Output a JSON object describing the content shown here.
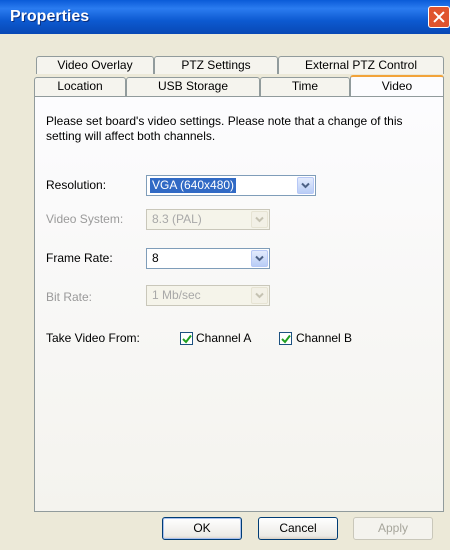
{
  "window": {
    "title": "Properties"
  },
  "tabs": {
    "row_back": [
      {
        "label": "Video Overlay"
      },
      {
        "label": "PTZ Settings"
      },
      {
        "label": "External PTZ Control"
      }
    ],
    "row_front": [
      {
        "label": "Location"
      },
      {
        "label": "USB Storage"
      },
      {
        "label": "Time"
      },
      {
        "label": "Video",
        "active": true
      }
    ]
  },
  "panel": {
    "description": "Please set board's video settings. Please note that a change of this setting will affect both channels.",
    "resolution": {
      "label": "Resolution:",
      "value": "VGA (640x480)",
      "enabled": true
    },
    "video_system": {
      "label": "Video System:",
      "value": "8.3 (PAL)",
      "enabled": false
    },
    "frame_rate": {
      "label": "Frame Rate:",
      "value": "8",
      "enabled": true
    },
    "bit_rate": {
      "label": "Bit Rate:",
      "value": "1 Mb/sec",
      "enabled": false
    },
    "take_video_from": {
      "label": "Take Video From:",
      "channel_a": {
        "label": "Channel A",
        "checked": true
      },
      "channel_b": {
        "label": "Channel B",
        "checked": true
      }
    }
  },
  "buttons": {
    "ok": "OK",
    "cancel": "Cancel",
    "apply": "Apply"
  },
  "colors": {
    "titlebar": "#0a5bd8",
    "active_tab_accent": "#f2a33a",
    "selection": "#316ac5"
  }
}
